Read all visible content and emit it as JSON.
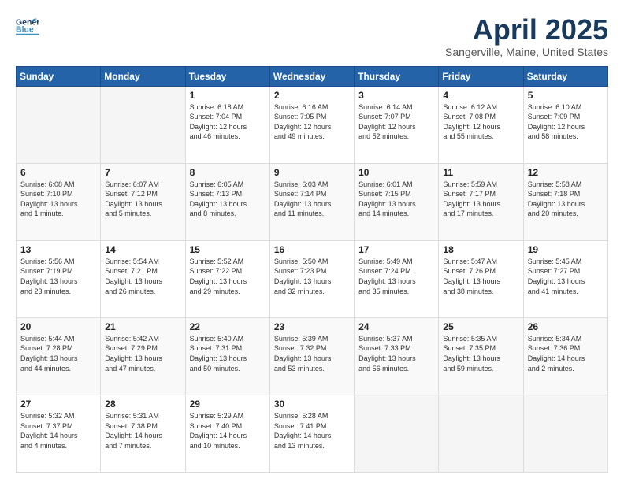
{
  "header": {
    "logo_general": "General",
    "logo_blue": "Blue",
    "title": "April 2025",
    "subtitle": "Sangerville, Maine, United States"
  },
  "days_of_week": [
    "Sunday",
    "Monday",
    "Tuesday",
    "Wednesday",
    "Thursday",
    "Friday",
    "Saturday"
  ],
  "weeks": [
    [
      {
        "day": "",
        "info": ""
      },
      {
        "day": "",
        "info": ""
      },
      {
        "day": "1",
        "info": "Sunrise: 6:18 AM\nSunset: 7:04 PM\nDaylight: 12 hours\nand 46 minutes."
      },
      {
        "day": "2",
        "info": "Sunrise: 6:16 AM\nSunset: 7:05 PM\nDaylight: 12 hours\nand 49 minutes."
      },
      {
        "day": "3",
        "info": "Sunrise: 6:14 AM\nSunset: 7:07 PM\nDaylight: 12 hours\nand 52 minutes."
      },
      {
        "day": "4",
        "info": "Sunrise: 6:12 AM\nSunset: 7:08 PM\nDaylight: 12 hours\nand 55 minutes."
      },
      {
        "day": "5",
        "info": "Sunrise: 6:10 AM\nSunset: 7:09 PM\nDaylight: 12 hours\nand 58 minutes."
      }
    ],
    [
      {
        "day": "6",
        "info": "Sunrise: 6:08 AM\nSunset: 7:10 PM\nDaylight: 13 hours\nand 1 minute."
      },
      {
        "day": "7",
        "info": "Sunrise: 6:07 AM\nSunset: 7:12 PM\nDaylight: 13 hours\nand 5 minutes."
      },
      {
        "day": "8",
        "info": "Sunrise: 6:05 AM\nSunset: 7:13 PM\nDaylight: 13 hours\nand 8 minutes."
      },
      {
        "day": "9",
        "info": "Sunrise: 6:03 AM\nSunset: 7:14 PM\nDaylight: 13 hours\nand 11 minutes."
      },
      {
        "day": "10",
        "info": "Sunrise: 6:01 AM\nSunset: 7:15 PM\nDaylight: 13 hours\nand 14 minutes."
      },
      {
        "day": "11",
        "info": "Sunrise: 5:59 AM\nSunset: 7:17 PM\nDaylight: 13 hours\nand 17 minutes."
      },
      {
        "day": "12",
        "info": "Sunrise: 5:58 AM\nSunset: 7:18 PM\nDaylight: 13 hours\nand 20 minutes."
      }
    ],
    [
      {
        "day": "13",
        "info": "Sunrise: 5:56 AM\nSunset: 7:19 PM\nDaylight: 13 hours\nand 23 minutes."
      },
      {
        "day": "14",
        "info": "Sunrise: 5:54 AM\nSunset: 7:21 PM\nDaylight: 13 hours\nand 26 minutes."
      },
      {
        "day": "15",
        "info": "Sunrise: 5:52 AM\nSunset: 7:22 PM\nDaylight: 13 hours\nand 29 minutes."
      },
      {
        "day": "16",
        "info": "Sunrise: 5:50 AM\nSunset: 7:23 PM\nDaylight: 13 hours\nand 32 minutes."
      },
      {
        "day": "17",
        "info": "Sunrise: 5:49 AM\nSunset: 7:24 PM\nDaylight: 13 hours\nand 35 minutes."
      },
      {
        "day": "18",
        "info": "Sunrise: 5:47 AM\nSunset: 7:26 PM\nDaylight: 13 hours\nand 38 minutes."
      },
      {
        "day": "19",
        "info": "Sunrise: 5:45 AM\nSunset: 7:27 PM\nDaylight: 13 hours\nand 41 minutes."
      }
    ],
    [
      {
        "day": "20",
        "info": "Sunrise: 5:44 AM\nSunset: 7:28 PM\nDaylight: 13 hours\nand 44 minutes."
      },
      {
        "day": "21",
        "info": "Sunrise: 5:42 AM\nSunset: 7:29 PM\nDaylight: 13 hours\nand 47 minutes."
      },
      {
        "day": "22",
        "info": "Sunrise: 5:40 AM\nSunset: 7:31 PM\nDaylight: 13 hours\nand 50 minutes."
      },
      {
        "day": "23",
        "info": "Sunrise: 5:39 AM\nSunset: 7:32 PM\nDaylight: 13 hours\nand 53 minutes."
      },
      {
        "day": "24",
        "info": "Sunrise: 5:37 AM\nSunset: 7:33 PM\nDaylight: 13 hours\nand 56 minutes."
      },
      {
        "day": "25",
        "info": "Sunrise: 5:35 AM\nSunset: 7:35 PM\nDaylight: 13 hours\nand 59 minutes."
      },
      {
        "day": "26",
        "info": "Sunrise: 5:34 AM\nSunset: 7:36 PM\nDaylight: 14 hours\nand 2 minutes."
      }
    ],
    [
      {
        "day": "27",
        "info": "Sunrise: 5:32 AM\nSunset: 7:37 PM\nDaylight: 14 hours\nand 4 minutes."
      },
      {
        "day": "28",
        "info": "Sunrise: 5:31 AM\nSunset: 7:38 PM\nDaylight: 14 hours\nand 7 minutes."
      },
      {
        "day": "29",
        "info": "Sunrise: 5:29 AM\nSunset: 7:40 PM\nDaylight: 14 hours\nand 10 minutes."
      },
      {
        "day": "30",
        "info": "Sunrise: 5:28 AM\nSunset: 7:41 PM\nDaylight: 14 hours\nand 13 minutes."
      },
      {
        "day": "",
        "info": ""
      },
      {
        "day": "",
        "info": ""
      },
      {
        "day": "",
        "info": ""
      }
    ]
  ]
}
